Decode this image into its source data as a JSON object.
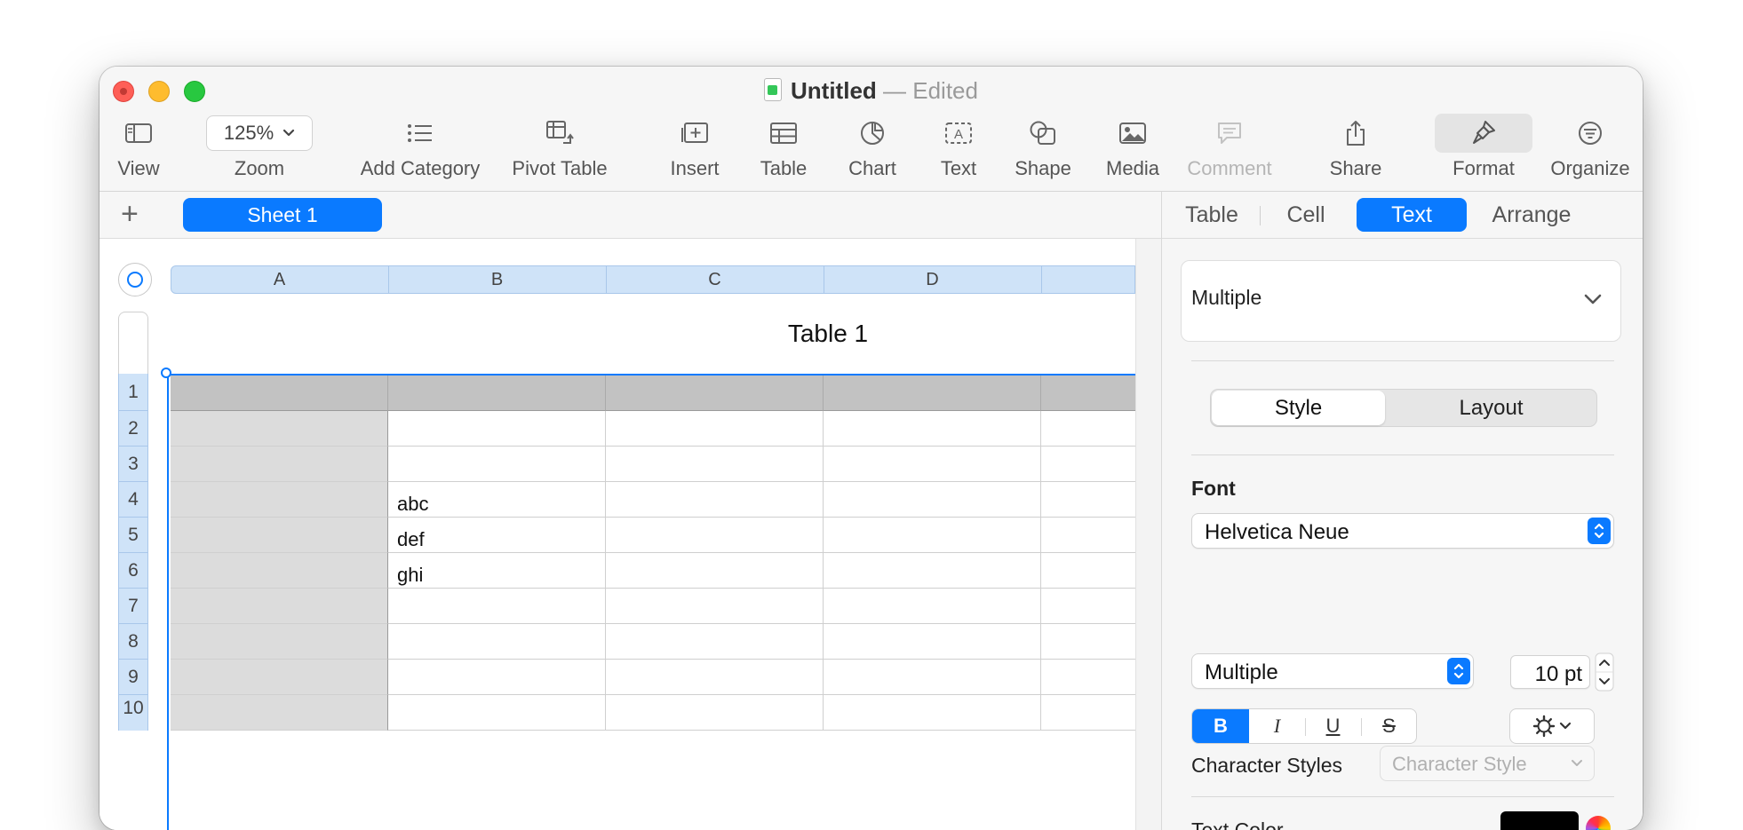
{
  "window": {
    "doc_title": "Untitled",
    "title_separator": "—",
    "edited_label": "Edited"
  },
  "toolbar": {
    "view": "View",
    "zoom_value": "125%",
    "zoom": "Zoom",
    "add_category": "Add Category",
    "pivot_table": "Pivot Table",
    "insert": "Insert",
    "table": "Table",
    "chart": "Chart",
    "text": "Text",
    "shape": "Shape",
    "media": "Media",
    "comment": "Comment",
    "share": "Share",
    "format": "Format",
    "organize": "Organize",
    "text_icon_glyph": "A"
  },
  "sheets": {
    "add": "+",
    "active": "Sheet 1"
  },
  "inspector": {
    "tabs": [
      "Table",
      "Cell",
      "Text",
      "Arrange"
    ],
    "active_tab": "Text",
    "paragraph_style": "Multiple",
    "segments": [
      "Style",
      "Layout"
    ],
    "font_heading": "Font",
    "font_family": "Helvetica Neue",
    "font_typeface": "Multiple",
    "font_size": "10 pt",
    "bold": "B",
    "italic": "I",
    "underline": "U",
    "strike": "S",
    "character_styles_label": "Character Styles",
    "character_style_placeholder": "Character Style",
    "text_color_label": "Text Color"
  },
  "sheet": {
    "columns": [
      "A",
      "B",
      "C",
      "D"
    ],
    "table_title": "Table 1",
    "rows": [
      "1",
      "2",
      "3",
      "4",
      "5",
      "6",
      "7",
      "8",
      "9"
    ],
    "column_b_values": [
      "",
      "",
      "",
      "abc",
      "def",
      "ghi",
      "",
      "",
      ""
    ],
    "partial_row": "10"
  },
  "colors": {
    "accent": "#0a7aff",
    "header_row": "#c2c2c2",
    "header_column": "#dcdcdc",
    "column_header_bar": "#cfe3f8"
  }
}
